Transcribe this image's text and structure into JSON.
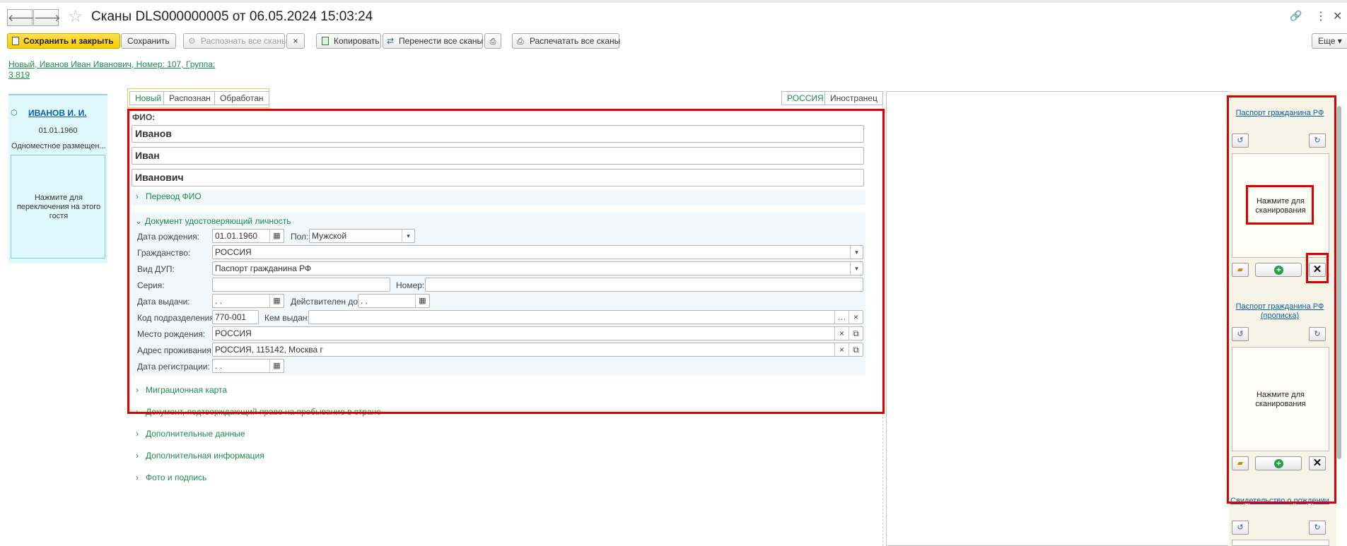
{
  "window": {
    "title": "Сканы DLS000000005 от 06.05.2024 15:03:24",
    "nav_back_icon": "🡐",
    "nav_forward_icon": "🡒",
    "star_icon": "☆",
    "link_icon": "🔗",
    "more_icon": "⋮",
    "close_icon": "✕"
  },
  "toolbar": {
    "save_close_label": "Сохранить и закрыть",
    "save_label": "Сохранить",
    "recognize_all_label": "Распознать все сканы",
    "cancel_label": "×",
    "copy_label": "Копировать",
    "move_all_label": "Перенести все сканы",
    "print_all_label": "Распечатать все сканы",
    "more_label": "Еще ▾"
  },
  "info_link": {
    "line1": "Новый, Иванов Иван Иванович, Номер: 107, Группа:",
    "line2": "3 819"
  },
  "guest_card": {
    "name": "ИВАНОВ И. И.",
    "birth_date": "01.01.1960",
    "accommodation": "Одноместное размещен...",
    "switch_text": "Нажмите для переключения на этого гостя"
  },
  "status_tabs": [
    "Новый",
    "Распознан",
    "Обработан"
  ],
  "country_tabs": [
    "РОССИЯ",
    "Иностранец"
  ],
  "form": {
    "fio_label": "ФИО:",
    "last_name": "Иванов",
    "first_name": "Иван",
    "middle_name": "Иванович",
    "fio_translation_section": "Перевод ФИО",
    "id_document_section": "Документ удостоверяющий личность",
    "birth_date_label": "Дата рождения:",
    "birth_date_value": "01.01.1960",
    "gender_label": "Пол:",
    "gender_value": "Мужской",
    "citizenship_label": "Гражданство:",
    "citizenship_value": "РОССИЯ",
    "doc_type_label": "Вид ДУП:",
    "doc_type_value": "Паспорт гражданина РФ",
    "series_label": "Серия:",
    "series_value": "",
    "number_label": "Номер:",
    "number_value": "",
    "issue_date_label": "Дата выдачи:",
    "issue_date_value": " .  .",
    "valid_until_label": "Действителен до:",
    "valid_until_value": " .  .",
    "division_code_label": "Код подразделения:",
    "division_code_value": "770-001",
    "issued_by_label": "Кем выдан:",
    "issued_by_value": "",
    "birth_place_label": "Место рождения:",
    "birth_place_value": "РОССИЯ",
    "address_label": "Адрес проживания:",
    "address_value": "РОССИЯ, 115142, Москва г",
    "registration_date_label": "Дата регистрации:",
    "registration_date_value": " .  .",
    "migration_card_section": "Миграционная карта",
    "stay_right_section": "Документ, подтверждающий право на пребывание в стране",
    "additional_data_section": "Дополнительные данные",
    "additional_info_section": "Дополнительная информация",
    "photo_signature_section": "Фото и подпись"
  },
  "scans": [
    {
      "title": "Паспорт гражданина РФ",
      "prompt": "Нажмите для сканирования"
    },
    {
      "title": "Паспорт гражданина РФ (прописка)",
      "prompt": "Нажмите для сканирования"
    },
    {
      "title": "Свидетельство о рождении"
    }
  ],
  "colors": {
    "accent_green": "#1a8d4a",
    "highlight_red": "#e00000",
    "save_yellow": "#f5cc00",
    "guest_card_bg": "#dff8fb"
  }
}
